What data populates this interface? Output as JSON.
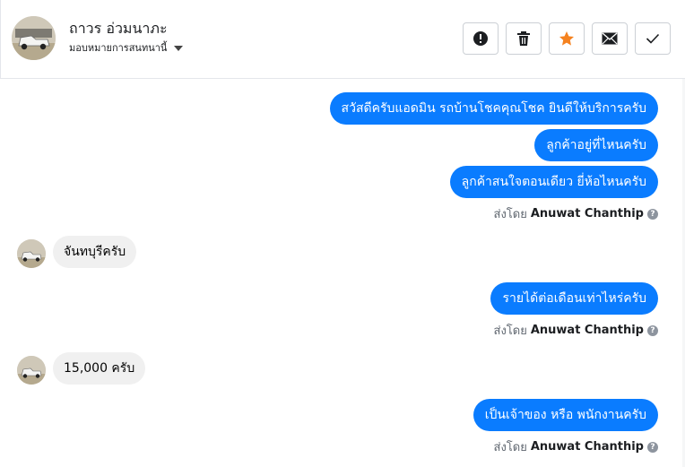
{
  "header": {
    "contact_name": "ถาวร อ่วมนาภะ",
    "assign_label": "มอบหมายการสนทนานี้",
    "actions": [
      {
        "name": "report-button",
        "icon": "exclamation-icon"
      },
      {
        "name": "delete-button",
        "icon": "trash-icon"
      },
      {
        "name": "star-button",
        "icon": "star-icon",
        "color": "#f5821f"
      },
      {
        "name": "unread-button",
        "icon": "envelope-icon"
      },
      {
        "name": "done-button",
        "icon": "checkmark-icon"
      }
    ]
  },
  "messages": {
    "out1": "สวัสดีครับแอดมิน รถบ้านโชคคุณโชค ยินดีให้บริการครับ",
    "out2": "ลูกค้าอยู่ที่ไหนครับ",
    "out3": "ลูกค้าสนใจตอนเดียว ยี่ห้อไหนครับ",
    "in1": "จันทบุรีครับ",
    "out4": "รายได้ต่อเดือนเท่าไหร่ครับ",
    "in2": "15,000 ครับ",
    "out5": "เป็นเจ้าของ หรือ พนักงานครับ"
  },
  "sent_by": {
    "prefix": "ส่งโดย",
    "name": "Anuwat Chanthip",
    "help": "?"
  },
  "colors": {
    "outgoing_bubble": "#0a7cff",
    "incoming_bubble": "#f0f0f0"
  }
}
